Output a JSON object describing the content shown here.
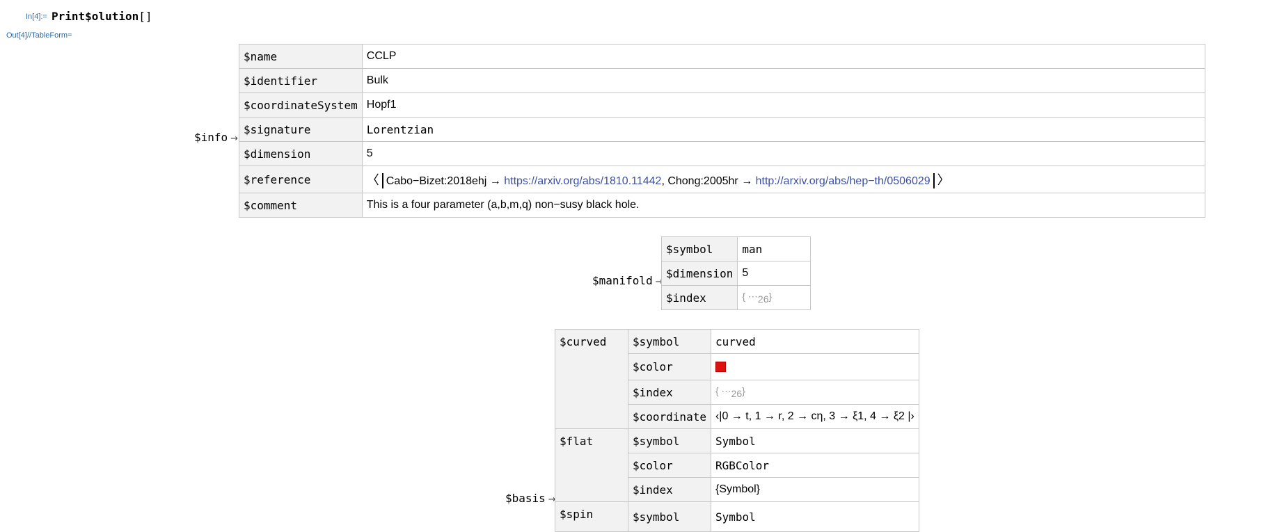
{
  "input": {
    "label": "In[4]:=",
    "code": "Print$olution",
    "brackets": "[]"
  },
  "output": {
    "label": "Out[4]//TableForm="
  },
  "info": {
    "label": "$info",
    "arrow": "→",
    "rows": [
      {
        "key": "$name",
        "value": "CCLP"
      },
      {
        "key": "$identifier",
        "value": "Bulk"
      },
      {
        "key": "$coordinateSystem",
        "value": "Hopf1"
      },
      {
        "key": "$signature",
        "value": "Lorentzian"
      },
      {
        "key": "$dimension",
        "value": "5"
      },
      {
        "key": "$reference",
        "ref1_key": "Cabo−Bizet:2018ehj",
        "ref1_url": "https://arxiv.org/abs/1810.11442",
        "ref2_key": "Chong:2005hr",
        "ref2_url": "http://arxiv.org/abs/hep−th/0506029"
      },
      {
        "key": "$comment",
        "value": "This is a four parameter (a,b,m,q) non−susy black hole."
      }
    ]
  },
  "manifold": {
    "label": "$manifold",
    "arrow": "→",
    "rows": [
      {
        "key": "$symbol",
        "value": "man"
      },
      {
        "key": "$dimension",
        "value": "5"
      },
      {
        "key": "$index",
        "value": "{ ⋯",
        "count": "26",
        "close": "}"
      }
    ]
  },
  "basis": {
    "label": "$basis",
    "arrow": "→",
    "curved": {
      "key": "$curved",
      "symbol_key": "$symbol",
      "symbol_val": "curved",
      "color_key": "$color",
      "color_val": "#e01010",
      "index_key": "$index",
      "index_val": "{ ⋯",
      "index_count": "26",
      "index_close": "}",
      "coord_key": "$coordinate",
      "coord_val": "‹|0 → t, 1 → r, 2 → cη, 3 → ξ1, 4 → ξ2 |›"
    },
    "flat": {
      "key": "$flat",
      "symbol_key": "$symbol",
      "symbol_val": "Symbol",
      "color_key": "$color",
      "color_val": "RGBColor",
      "index_key": "$index",
      "index_val": "{Symbol}"
    },
    "spin": {
      "key": "$spin",
      "symbol_key": "$symbol",
      "symbol_val": "Symbol"
    }
  }
}
